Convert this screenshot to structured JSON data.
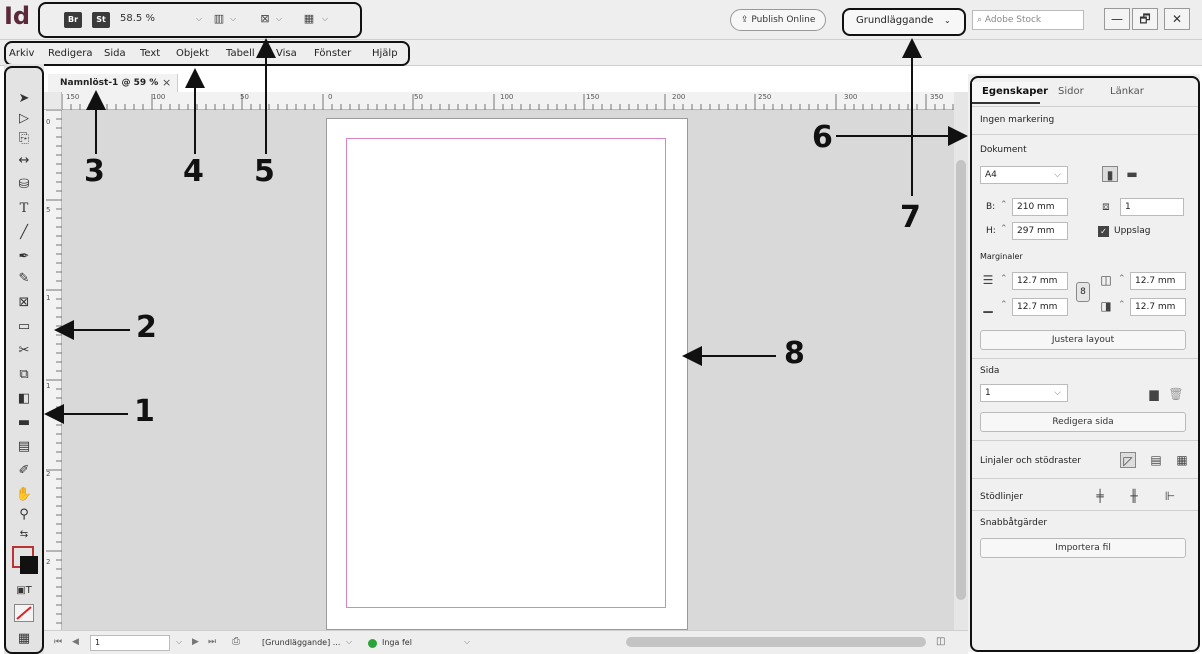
{
  "app": {
    "logo": "Id"
  },
  "toolbar": {
    "bridge_badge": "Br",
    "stock_badge": "St",
    "zoom": "58.5 %",
    "icon_names": [
      "screen-mode-icon",
      "view-options-icon",
      "arrange-documents-icon"
    ]
  },
  "header": {
    "publish_label": "Publish Online",
    "workspace_label": "Grundläggande",
    "search_placeholder": "Adobe Stock",
    "window_controls": [
      "—",
      "🗗",
      "✕"
    ]
  },
  "menubar": {
    "items": [
      "Arkiv",
      "Redigera",
      "Sida",
      "Text",
      "Objekt",
      "Tabell",
      "Visa",
      "Fönster",
      "Hjälp"
    ]
  },
  "doc_tab": {
    "title": "Namnlöst-1 @ 59 %",
    "close": "×"
  },
  "ruler_h": [
    "150",
    "100",
    "50",
    "0",
    "50",
    "100",
    "150",
    "200",
    "250",
    "300",
    "350"
  ],
  "ruler_v": [
    "0",
    "5",
    "1",
    "1",
    "2",
    "2"
  ],
  "status": {
    "page": "1",
    "workspace": "[Grundläggande] ...",
    "errors": "Inga fel"
  },
  "panel": {
    "tabs": [
      "Egenskaper",
      "Sidor",
      "Länkar"
    ],
    "selection": "Ingen markering",
    "document_label": "Dokument",
    "preset": "A4",
    "width_label": "B:",
    "width": "210 mm",
    "height_label": "H:",
    "height": "297 mm",
    "pages": "1",
    "facing_label": "Uppslag",
    "margins_label": "Marginaler",
    "margin_top": "12.7 mm",
    "margin_bottom": "12.7 mm",
    "margin_left": "12.7 mm",
    "margin_right": "12.7 mm",
    "adjust_layout": "Justera layout",
    "page_section": "Sida",
    "page_value": "1",
    "edit_page": "Redigera sida",
    "rulers_grids": "Linjaler och stödraster",
    "guides": "Stödlinjer",
    "quick_actions": "Snabbåtgärder",
    "import_file": "Importera fil"
  },
  "callouts": [
    "1",
    "2",
    "3",
    "4",
    "5",
    "6",
    "7",
    "8"
  ],
  "colors": {
    "accent": "#d884c7",
    "outline": "#111111"
  }
}
